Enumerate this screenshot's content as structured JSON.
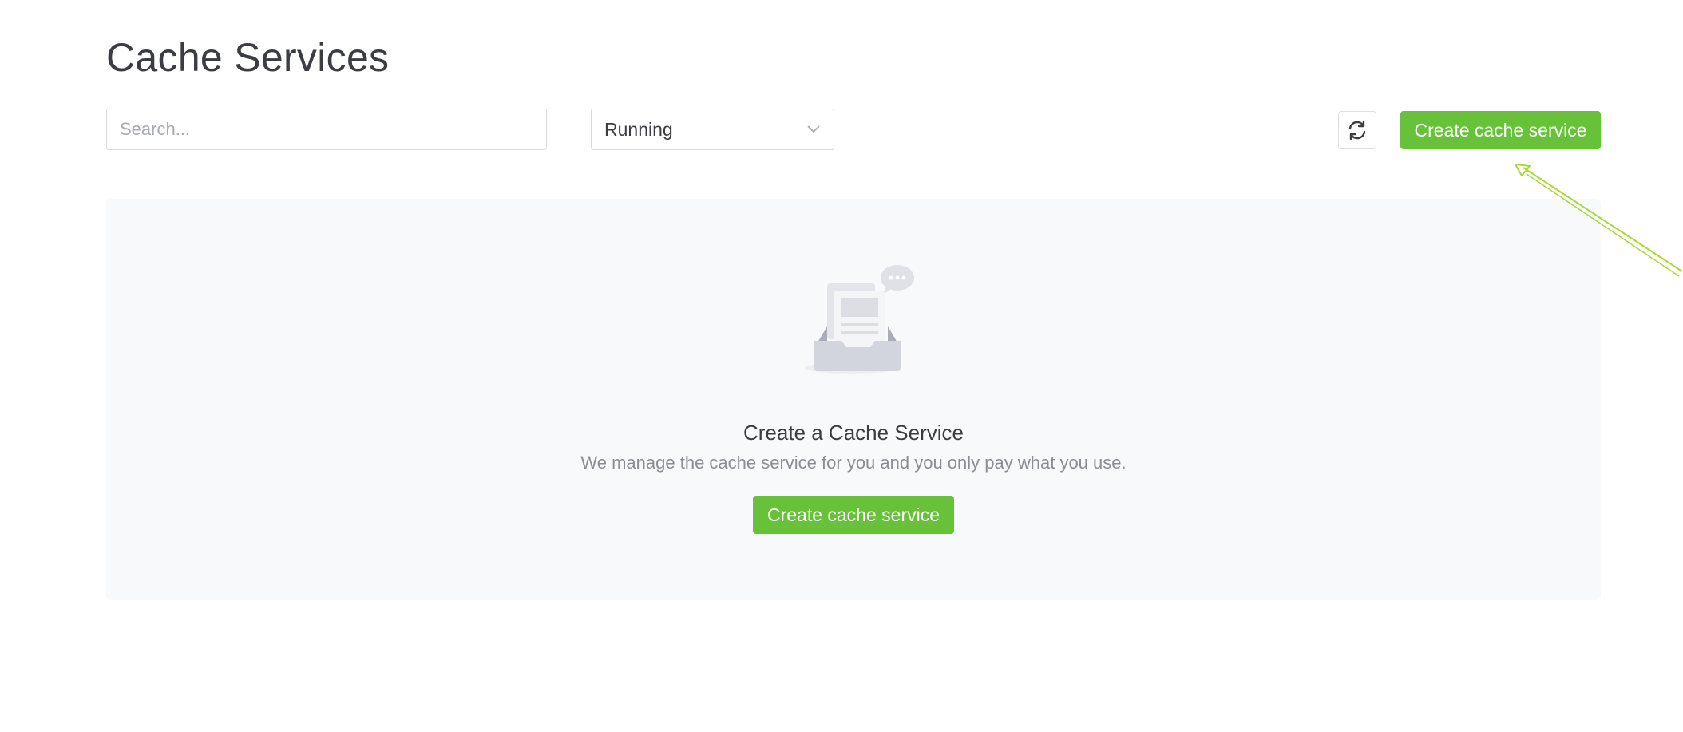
{
  "page": {
    "title": "Cache Services"
  },
  "toolbar": {
    "search_placeholder": "Search...",
    "status_filter": {
      "selected": "Running"
    },
    "refresh_icon": "refresh-icon",
    "create_button_label": "Create cache service"
  },
  "empty_state": {
    "illustration_icon": "empty-inbox-icon",
    "title": "Create a Cache Service",
    "subtitle": "We manage the cache service for you and you only pay what you use.",
    "create_button_label": "Create cache service"
  },
  "colors": {
    "primary_button": "#67c23a",
    "annotation_arrow": "#a8d935",
    "panel_background": "#f8f9fa"
  }
}
